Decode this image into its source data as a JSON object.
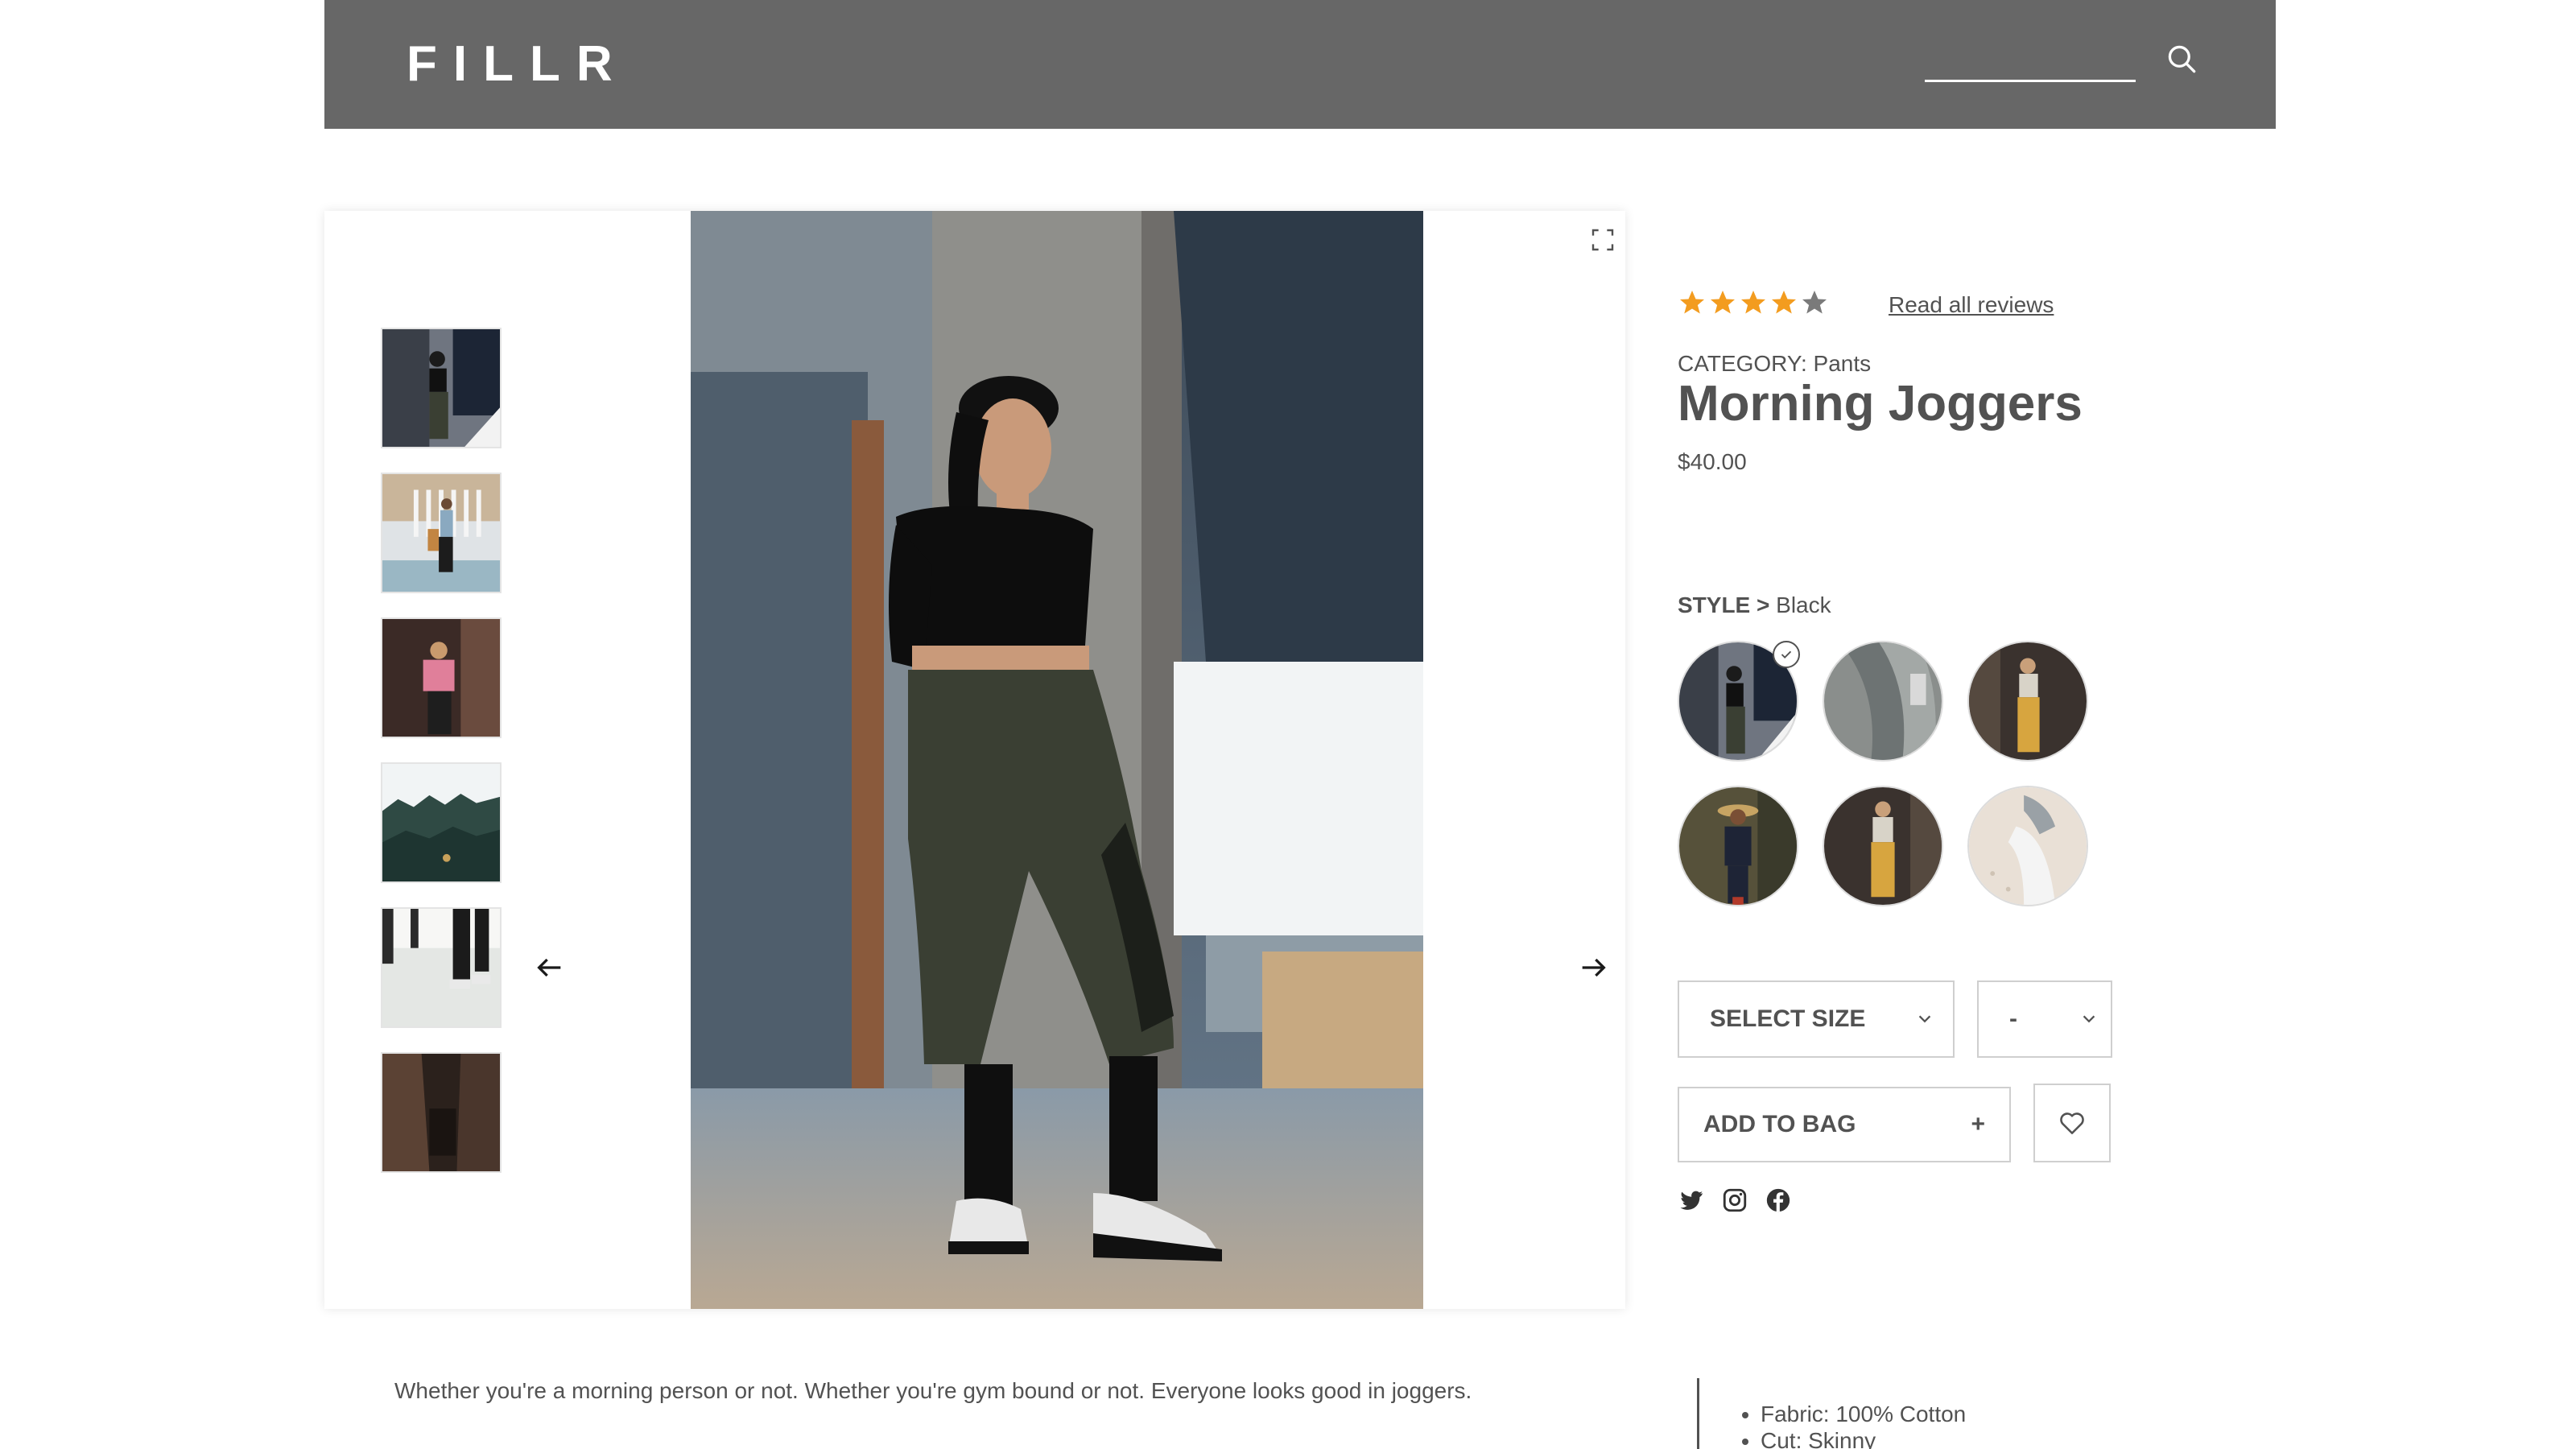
{
  "header": {
    "logo": "FILLR",
    "search_placeholder": "",
    "search_icon": "search-icon"
  },
  "gallery": {
    "thumbnails": [
      {
        "name": "thumbnail-1"
      },
      {
        "name": "thumbnail-2"
      },
      {
        "name": "thumbnail-3"
      },
      {
        "name": "thumbnail-4"
      },
      {
        "name": "thumbnail-5"
      },
      {
        "name": "thumbnail-6"
      }
    ],
    "prev_icon": "arrow-left-icon",
    "next_icon": "arrow-right-icon",
    "expand_icon": "expand-icon"
  },
  "product": {
    "rating": 4,
    "rating_max": 5,
    "reviews_link": "Read all reviews",
    "category": "CATEGORY: Pants",
    "name": "Morning Joggers",
    "price": "$40.00",
    "style_label": "STYLE >",
    "style_selected": "Black",
    "styles_count_selected_index": 0,
    "size_select": "SELECT SIZE",
    "quantity_select": "-",
    "add_to_bag": "ADD TO BAG",
    "add_to_bag_symbol": "+"
  },
  "social": [
    "twitter-icon",
    "instagram-icon",
    "facebook-icon"
  ],
  "description": "Whether you're a morning person or not. Whether you're gym bound or not. Everyone looks good in joggers.",
  "features": [
    "Fabric: 100% Cotton",
    "Cut: Skinny"
  ],
  "colors": {
    "header_bg": "#676767",
    "star": "#f39c1f",
    "star_empty": "#7a7a7a",
    "text": "#525252"
  }
}
